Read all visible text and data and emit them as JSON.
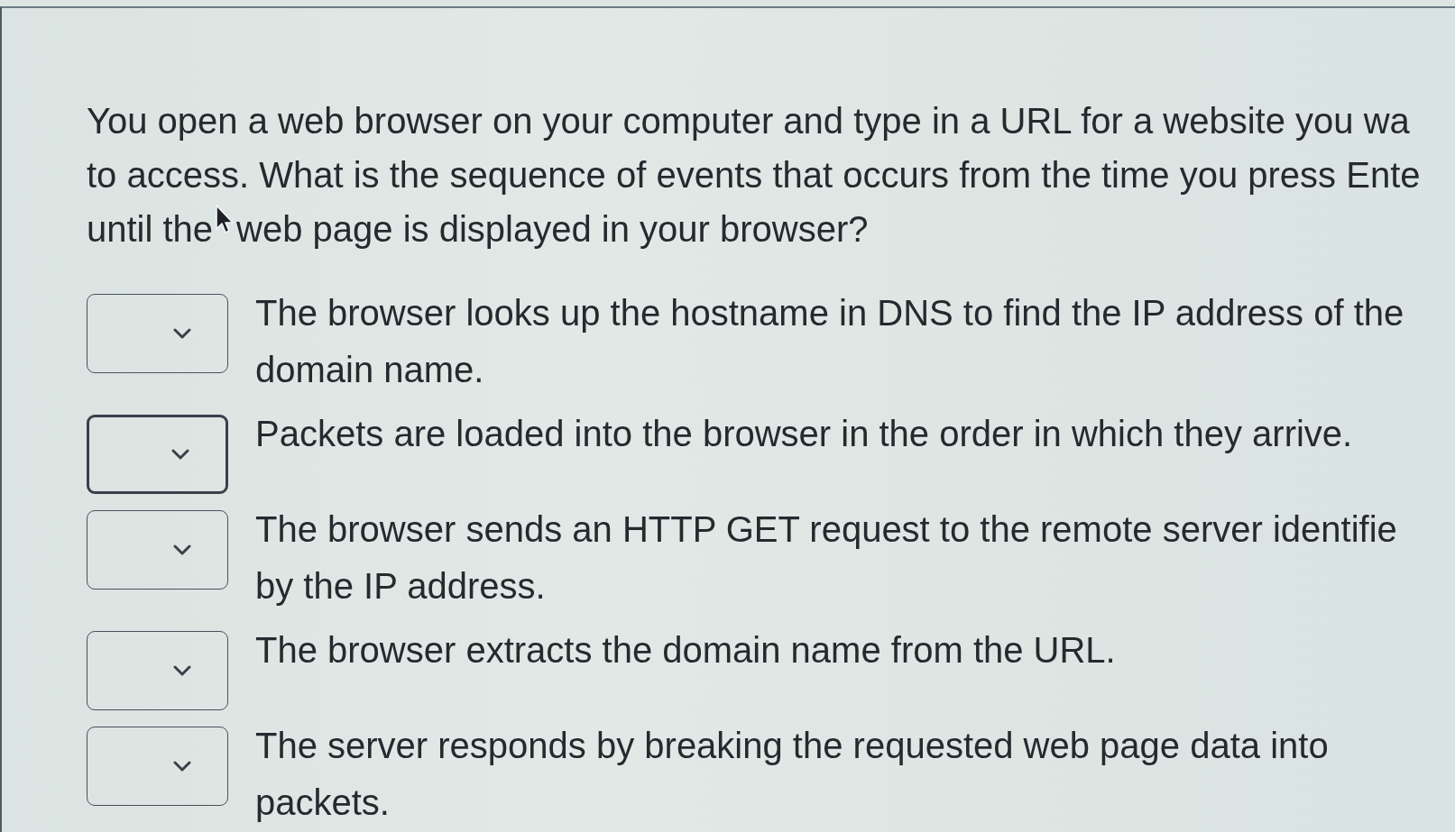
{
  "question": {
    "lines": [
      [
        "You open a web browser on your computer and type in a URL for a website you wa"
      ],
      [
        "to access. What is the sequence of events that occurs from the time you press Ente"
      ],
      [
        "until the",
        "web page is displayed in your browser?"
      ]
    ]
  },
  "answers": [
    {
      "focused": false,
      "lines": [
        "The browser looks up the hostname in DNS to find the IP address of the",
        "domain name."
      ]
    },
    {
      "focused": true,
      "lines": [
        "Packets are loaded into the browser in the order in which they arrive."
      ]
    },
    {
      "focused": false,
      "lines": [
        "The browser sends an HTTP GET request to the remote server identifie",
        "by the IP address."
      ]
    },
    {
      "focused": false,
      "lines": [
        "The browser extracts the domain name from the URL."
      ]
    },
    {
      "focused": false,
      "lines": [
        "The server responds by breaking the requested web page data into",
        "packets."
      ]
    }
  ]
}
